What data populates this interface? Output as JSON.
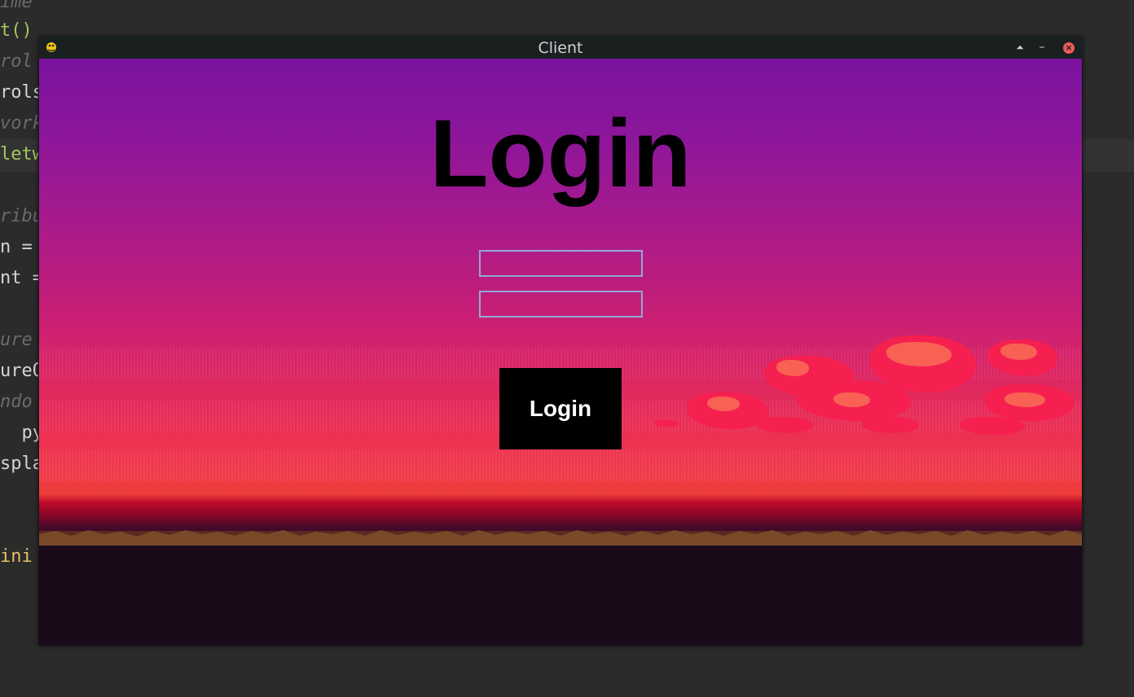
{
  "editor": {
    "lines": [
      {
        "text": "ime",
        "style": "comment"
      },
      {
        "text": "t()",
        "style": "green"
      },
      {
        "text": "rol",
        "style": "comment"
      },
      {
        "text": "rols",
        "style": "normal"
      },
      {
        "text": "vork",
        "style": "comment"
      },
      {
        "text": "letw",
        "style": "green"
      },
      {
        "text": "ribu",
        "style": "comment"
      },
      {
        "text": "n =",
        "style": "normal"
      },
      {
        "text": "nt =",
        "style": "normal"
      },
      {
        "text": "ure",
        "style": "comment"
      },
      {
        "text": "ureO",
        "style": "normal"
      },
      {
        "text": "ndo",
        "style": "comment"
      },
      {
        "text": "  py",
        "style": "normal"
      },
      {
        "text": "spla",
        "style": "normal"
      },
      {
        "text": "ini",
        "style": "yellow"
      }
    ]
  },
  "window": {
    "title": "Client",
    "icon": "pygame-snake-icon",
    "buttons": {
      "shade": "⏶",
      "minimize": "–",
      "close": "×"
    }
  },
  "game": {
    "heading": "Login",
    "username_value": "",
    "password_value": "",
    "login_button_label": "Login",
    "colors": {
      "sky_top": "#7a139e",
      "sky_mid": "#c01d7a",
      "sky_horizon": "#f13a4a",
      "ground": "#1a0b1b",
      "cloud": "#f5204f",
      "field_border": "#8fa9d4",
      "button_bg": "#000000",
      "button_text": "#ffffff"
    }
  }
}
